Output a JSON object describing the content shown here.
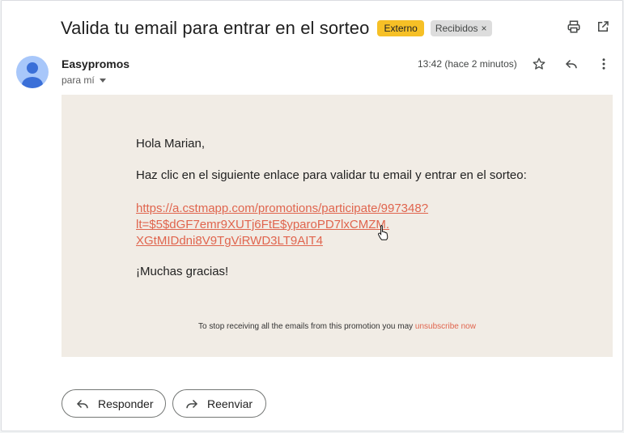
{
  "email": {
    "subject": "Valida tu email para entrar en el sorteo",
    "badge_external": "Externo",
    "label": "Recibidos",
    "label_remove": "×",
    "sender": "Easypromos",
    "recipient": "para mí",
    "time": "13:42 (hace 2 minutos)"
  },
  "body": {
    "greeting": "Hola Marian,",
    "instruction": "Haz clic en el siguiente enlace para validar tu email y entrar en el sorteo:",
    "link_lines": [
      "https://a.cstmapp.com/promotions/participate/997348?",
      "lt=$5$dGF7emr9XUTj6FtE$yparoPD7lxCMZM.",
      "XGtMIDdni8V9TgViRWD3LT9AIT4"
    ],
    "thanks": "¡Muchas gracias!",
    "footer_text": "To stop receiving all the emails from this promotion you may ",
    "unsubscribe_label": "unsubscribe now"
  },
  "actions": {
    "reply_label": "Responder",
    "forward_label": "Reenviar"
  },
  "icons": {
    "print": "print-icon",
    "open_new": "open-in-new-icon",
    "star": "star-icon",
    "reply": "reply-icon",
    "more": "more-vert-icon",
    "forward": "forward-icon",
    "avatar": "avatar-icon",
    "cursor": "hand-cursor-icon"
  },
  "colors": {
    "external_badge": "#f6c026",
    "body_background": "#f1ece5",
    "link": "#e0654e"
  }
}
